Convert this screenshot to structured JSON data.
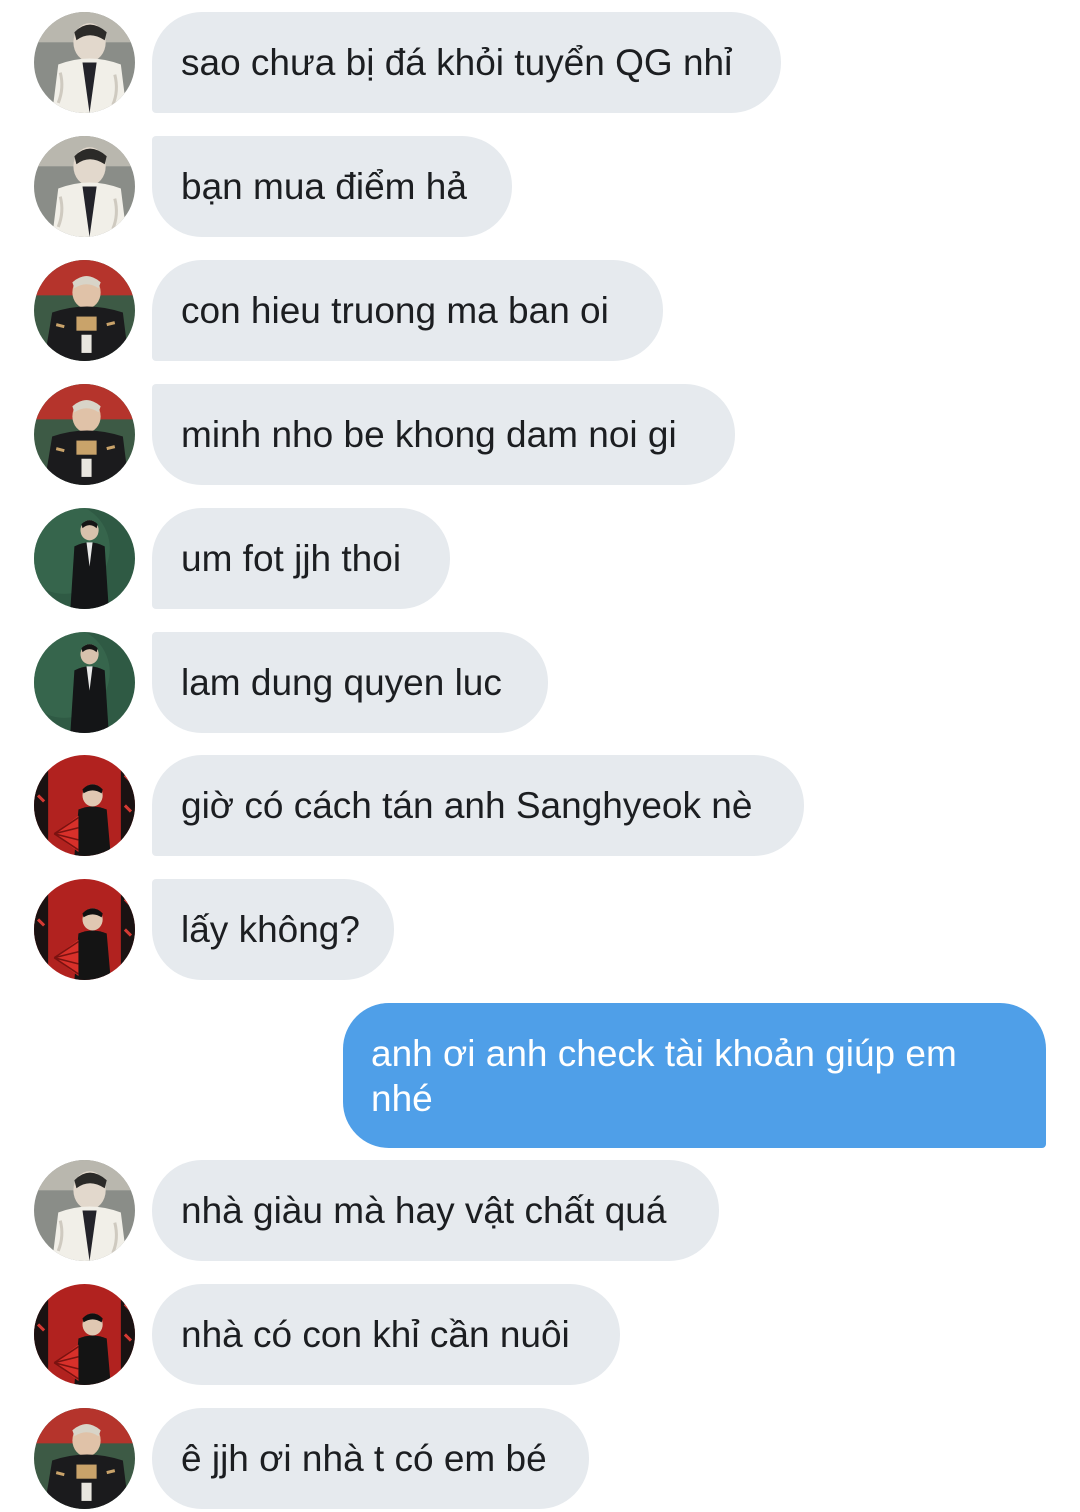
{
  "messages": [
    {
      "text": "sao chưa bị đá khỏi tuyển QG nhỉ",
      "avatar": "avatar-white-jacket"
    },
    {
      "text": "bạn mua điểm hả",
      "avatar": "avatar-white-jacket"
    },
    {
      "text": "con hieu truong ma ban oi",
      "avatar": "avatar-black-jersey"
    },
    {
      "text": "minh nho be khong dam noi gi",
      "avatar": "avatar-black-jersey"
    },
    {
      "text": "um fot jjh thoi",
      "avatar": "avatar-black-suit"
    },
    {
      "text": "lam dung quyen luc",
      "avatar": "avatar-black-suit"
    },
    {
      "text": "giờ có cách tán anh Sanghyeok nè",
      "avatar": "avatar-red-fan"
    },
    {
      "text": "lấy không?",
      "avatar": "avatar-red-fan"
    },
    {
      "text": "anh ơi anh check tài khoản giúp em nhé",
      "outgoing": true
    },
    {
      "text": "nhà giàu mà hay vật chất quá",
      "avatar": "avatar-white-jacket"
    },
    {
      "text": "nhà có con khỉ cần nuôi",
      "avatar": "avatar-red-fan"
    },
    {
      "text": "ê jjh ơi nhà t có em bé",
      "avatar": "avatar-black-jersey"
    }
  ],
  "colors": {
    "incoming_bubble": "#e6eaee",
    "outgoing_bubble": "#4f9fe8",
    "text_dark": "#1c1e21",
    "text_light": "#ffffff"
  }
}
